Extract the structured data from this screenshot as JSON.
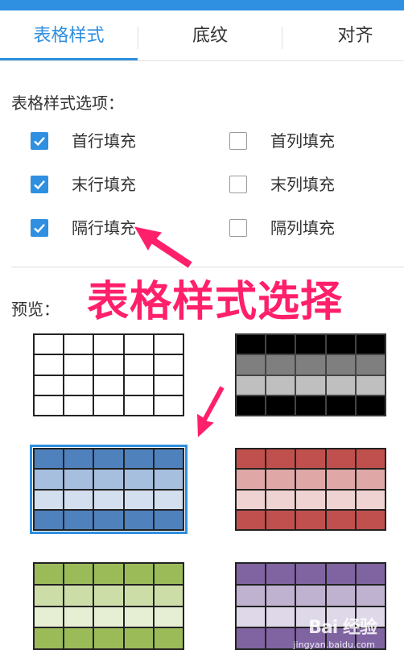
{
  "tabs": [
    {
      "label": "表格样式",
      "active": true
    },
    {
      "label": "底纹",
      "active": false
    },
    {
      "label": "对齐",
      "active": false
    }
  ],
  "options": {
    "title": "表格样式选项：",
    "items": [
      {
        "label": "首行填充",
        "checked": true
      },
      {
        "label": "首列填充",
        "checked": false
      },
      {
        "label": "末行填充",
        "checked": true
      },
      {
        "label": "末列填充",
        "checked": false
      },
      {
        "label": "隔行填充",
        "checked": true
      },
      {
        "label": "隔列填充",
        "checked": false
      }
    ]
  },
  "preview": {
    "title": "预览："
  },
  "styles": [
    {
      "id": "plain",
      "colors": {
        "header": "#ffffff",
        "band1": "#ffffff",
        "band2": "#ffffff",
        "footer": "#ffffff"
      },
      "selected": false
    },
    {
      "id": "gray",
      "colors": {
        "header": "#000000",
        "band1": "#7f7f7f",
        "band2": "#bfbfbf",
        "footer": "#000000"
      },
      "selected": false
    },
    {
      "id": "blue",
      "colors": {
        "header": "#4f81bd",
        "band1": "#a7bfde",
        "band2": "#d3dfee",
        "footer": "#4f81bd"
      },
      "selected": true
    },
    {
      "id": "red",
      "colors": {
        "header": "#c0504d",
        "band1": "#dfa7a6",
        "band2": "#efd3d2",
        "footer": "#c0504d"
      },
      "selected": false
    },
    {
      "id": "green",
      "colors": {
        "header": "#9bbb59",
        "band1": "#cddda7",
        "band2": "#e6eed3",
        "footer": "#9bbb59"
      },
      "selected": false
    },
    {
      "id": "purple",
      "colors": {
        "header": "#8064a2",
        "band1": "#bfb1d0",
        "band2": "#dfd8e8",
        "footer": "#8064a2"
      },
      "selected": false
    }
  ],
  "annotation": {
    "text": "表格样式选择",
    "color": "#ff1f6b"
  },
  "watermark": {
    "logo_text": "Bai 经验",
    "url": "jingyan.baidu.com"
  },
  "theme": {
    "accent": "#2f8fe0"
  }
}
